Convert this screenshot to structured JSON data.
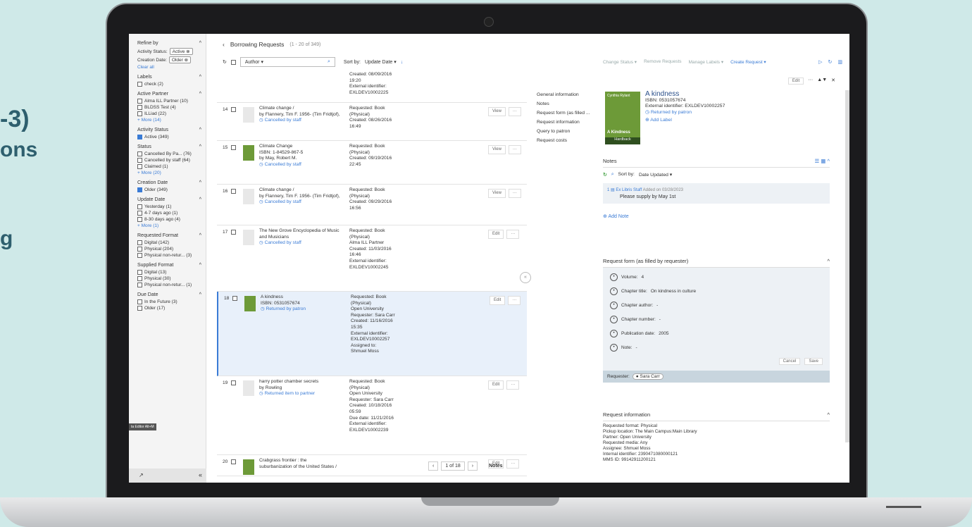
{
  "background": {
    "line1": "-3)",
    "line2": "ons",
    "line3": "g"
  },
  "facets": {
    "refine_by": "Refine by",
    "active_status_chip": "Active",
    "activity_status_label": "Activity Status:",
    "creation_date_label": "Creation Date:",
    "creation_date_chip": "Older",
    "clear_all": "Clear all",
    "groups": [
      {
        "title": "Labels",
        "items": [
          {
            "label": "check (2)",
            "checked": false
          }
        ]
      },
      {
        "title": "Active Partner",
        "items": [
          {
            "label": "Alma ILL Partner (10)",
            "checked": false
          },
          {
            "label": "BLDSS Test (4)",
            "checked": false
          },
          {
            "label": "ILLiad (22)",
            "checked": false
          }
        ],
        "more": "+ More (14)"
      },
      {
        "title": "Activity Status",
        "items": [
          {
            "label": "Active (349)",
            "checked": true
          }
        ]
      },
      {
        "title": "Status",
        "items": [
          {
            "label": "Cancelled By Pa... (76)",
            "checked": false
          },
          {
            "label": "Cancelled by staff (64)",
            "checked": false
          },
          {
            "label": "Claimed (1)",
            "checked": false
          }
        ],
        "more": "+ More (20)"
      },
      {
        "title": "Creation Date",
        "items": [
          {
            "label": "Older (349)",
            "checked": true
          }
        ]
      },
      {
        "title": "Update Date",
        "items": [
          {
            "label": "Yesterday (1)",
            "checked": false
          },
          {
            "label": "4-7 days ago (1)",
            "checked": false
          },
          {
            "label": "8-30 days ago (4)",
            "checked": false
          }
        ],
        "more": "+ More (1)"
      },
      {
        "title": "Requested Format",
        "items": [
          {
            "label": "Digital (142)",
            "checked": false
          },
          {
            "label": "Physical (204)",
            "checked": false
          },
          {
            "label": "Physical non-retur... (3)",
            "checked": false
          }
        ]
      },
      {
        "title": "Supplied Format",
        "items": [
          {
            "label": "Digital (13)",
            "checked": false
          },
          {
            "label": "Physical (30)",
            "checked": false
          },
          {
            "label": "Physical non-retur... (1)",
            "checked": false
          }
        ]
      },
      {
        "title": "Due Date",
        "items": [
          {
            "label": "In the Future (3)",
            "checked": false
          },
          {
            "label": "Older (17)",
            "checked": false
          }
        ]
      }
    ],
    "tooltip": "ta Editor Alt+M"
  },
  "list": {
    "title": "Borrowing Requests",
    "count": "(1 - 20 of 349)",
    "author_filter": "Author ▾",
    "sort_label": "Sort by:",
    "sort_value": "Update Date ▾",
    "pager": {
      "text": "1 of 18",
      "notes": "Notes"
    },
    "top_partial": [
      "Created: 08/09/2016",
      "19:20",
      "External identifier:",
      "EXLDEV10002225"
    ],
    "rows": [
      {
        "num": "14",
        "title": [
          "Climate change /",
          "by Flannery, Tim F. 1956- (Tim Fridtjof),"
        ],
        "status": "Cancelled by staff",
        "req": [
          "Requested: Book",
          "(Physical)",
          "Created: 08/26/2016",
          "16:49"
        ],
        "action": "View"
      },
      {
        "num": "15",
        "title": [
          "Climate Change",
          "ISBN: 1-84529-867-5",
          "by May, Robert M."
        ],
        "status": "Cancelled by staff",
        "req": [
          "Requested: Book",
          "(Physical)",
          "Created: 09/19/2016",
          "22:45"
        ],
        "action": "View"
      },
      {
        "num": "16",
        "title": [
          "Climate change /",
          "by Flannery, Tim F. 1956- (Tim Fridtjof),"
        ],
        "status": "Cancelled by staff",
        "req": [
          "Requested: Book",
          "(Physical)",
          "Created: 09/29/2016",
          "16:56"
        ],
        "action": "View"
      },
      {
        "num": "17",
        "title": [
          "The New Grove Encyclopedia of Music",
          "and Musicians"
        ],
        "status": "Cancelled by staff",
        "req": [
          "Requested: Book",
          "(Physical)",
          "Alma ILL Partner",
          "Created: 11/03/2016",
          "16:46",
          "External identifier:",
          "EXLDEV10002245"
        ],
        "action": "Edit"
      },
      {
        "num": "18",
        "title": [
          "A kindness",
          "ISBN: 0531057674"
        ],
        "status": "Returned by patron",
        "req": [
          "Requested: Book",
          "(Physical)",
          "Open University",
          "Requester: Sara Carr",
          "Created: 11/16/2016",
          "15:35",
          "External identifier:",
          "EXLDEV10002257",
          "Assigned to:",
          "Shmuel Moss"
        ],
        "action": "Edit"
      },
      {
        "num": "19",
        "title": [
          "harry potter chamber secrets",
          "by Rowling"
        ],
        "status": "Returned item to partner",
        "req": [
          "Requested: Book",
          "(Physical)",
          "Open University",
          "Requester: Sara Carr",
          "Created: 10/18/2016",
          "05:59",
          "Due date: 11/21/2016",
          "External identifier:",
          "EXLDEV10002239"
        ],
        "action": "Edit"
      },
      {
        "num": "20",
        "title": [
          "Crabgrass frontier : the",
          "suburbanization of the United States /"
        ],
        "status": "",
        "req": [],
        "action": "Edit"
      }
    ]
  },
  "detail": {
    "top_actions": [
      "Change Status ▾",
      "Remove Requests",
      "Manage Labels ▾"
    ],
    "create_request": "Create Request ▾",
    "edit": "Edit",
    "nav": [
      "General information",
      "Notes",
      "Request form (as filled ...",
      "Request information",
      "Query to patron",
      "Request costs"
    ],
    "book": {
      "cover_author": "Cynthia Rylant",
      "cover_title": "A Kindness",
      "cover_band": "Hardback",
      "title": "A kindness",
      "isbn": "ISBN: 0531057674",
      "ext_id": "External identifier: EXLDEV10002257",
      "status": "Returned by patron",
      "add_label": "Add Label"
    },
    "notes": {
      "title": "Notes",
      "sort_label": "Sort by:",
      "sort_value": "Date Updated ▾",
      "note_num": "1",
      "author": "Ex Libris Staff",
      "added": "Added on 03/28/2023",
      "text": "Please supply by May 1st",
      "add_note": "Add Note"
    },
    "form": {
      "title": "Request form (as filled by requester)",
      "fields": [
        {
          "label": "Volume:",
          "value": "4"
        },
        {
          "label": "Chapter title:",
          "value": "On kindness in culture"
        },
        {
          "label": "Chapter author:",
          "value": "-"
        },
        {
          "label": "Chapter number:",
          "value": "-"
        },
        {
          "label": "Publication date:",
          "value": "2005"
        },
        {
          "label": "Note:",
          "value": "-"
        }
      ],
      "cancel": "Cancel",
      "save": "Save",
      "requester_label": "Requester:",
      "requester": "Sara Carr"
    },
    "info": {
      "title": "Request information",
      "lines": [
        "Requested format: Physical",
        "Pickup location: The Main Campus:Main Library",
        "Partner: Open University",
        "Requested media: Any",
        "Assignee: Shmuel Moss",
        "Internal identifier: 2390471080000121",
        "MMS ID: 99142911200121"
      ]
    }
  }
}
